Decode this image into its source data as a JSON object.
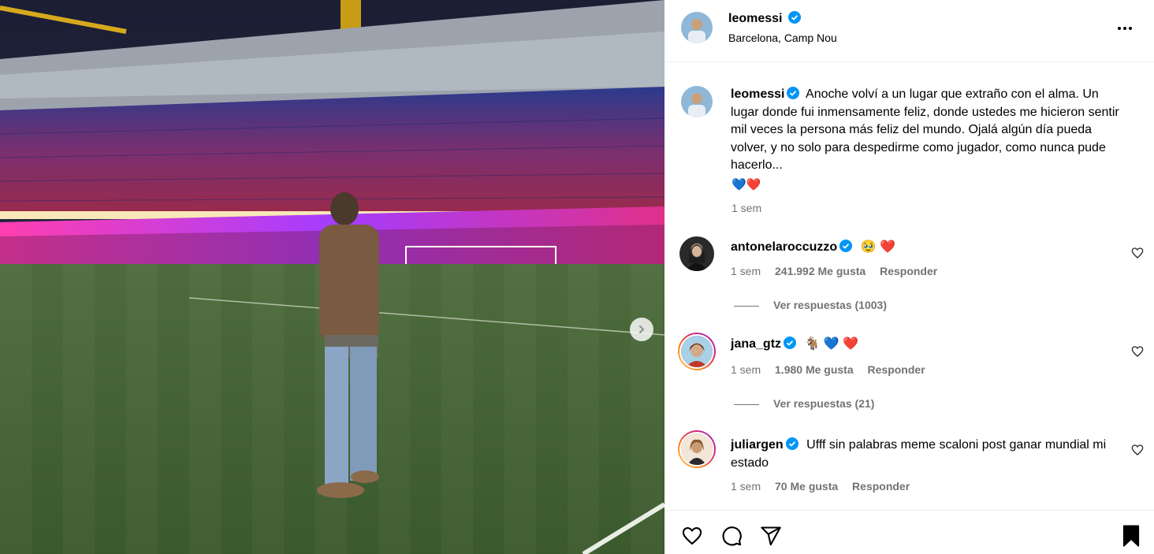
{
  "post": {
    "username": "leomessi",
    "location": "Barcelona, Camp Nou",
    "caption": "Anoche volví a un lugar que extraño con el alma. Un lugar donde fui inmensamente feliz, donde ustedes me hicieron sentir mil veces la persona más feliz del mundo. Ojalá algún día pueda volver, y no solo para despedirme como jugador, como nunca pude hacerlo...",
    "caption_emoji": "💙❤️",
    "time": "1 sem"
  },
  "comments": [
    {
      "username": "antonelaroccuzzo",
      "text": "🥹 ❤️",
      "time": "1 sem",
      "likes": "241.992 Me gusta",
      "reply_label": "Responder",
      "view_replies": "Ver respuestas (1003)"
    },
    {
      "username": "jana_gtz",
      "text": "🐐 💙 ❤️",
      "time": "1 sem",
      "likes": "1.980 Me gusta",
      "reply_label": "Responder",
      "view_replies": "Ver respuestas (21)"
    },
    {
      "username": "juliargen",
      "text": "Ufff sin palabras meme scaloni post ganar mundial mi estado",
      "time": "1 sem",
      "likes": "70 Me gusta",
      "reply_label": "Responder"
    }
  ],
  "colors": {
    "verified": "#0095f6",
    "secondary_text": "#737373",
    "divider": "#efefef"
  },
  "icons": {
    "header": "more-options-icon",
    "carousel": "chevron-right-icon",
    "actions": [
      "heart-icon",
      "comment-icon",
      "share-icon",
      "bookmark-icon"
    ]
  }
}
